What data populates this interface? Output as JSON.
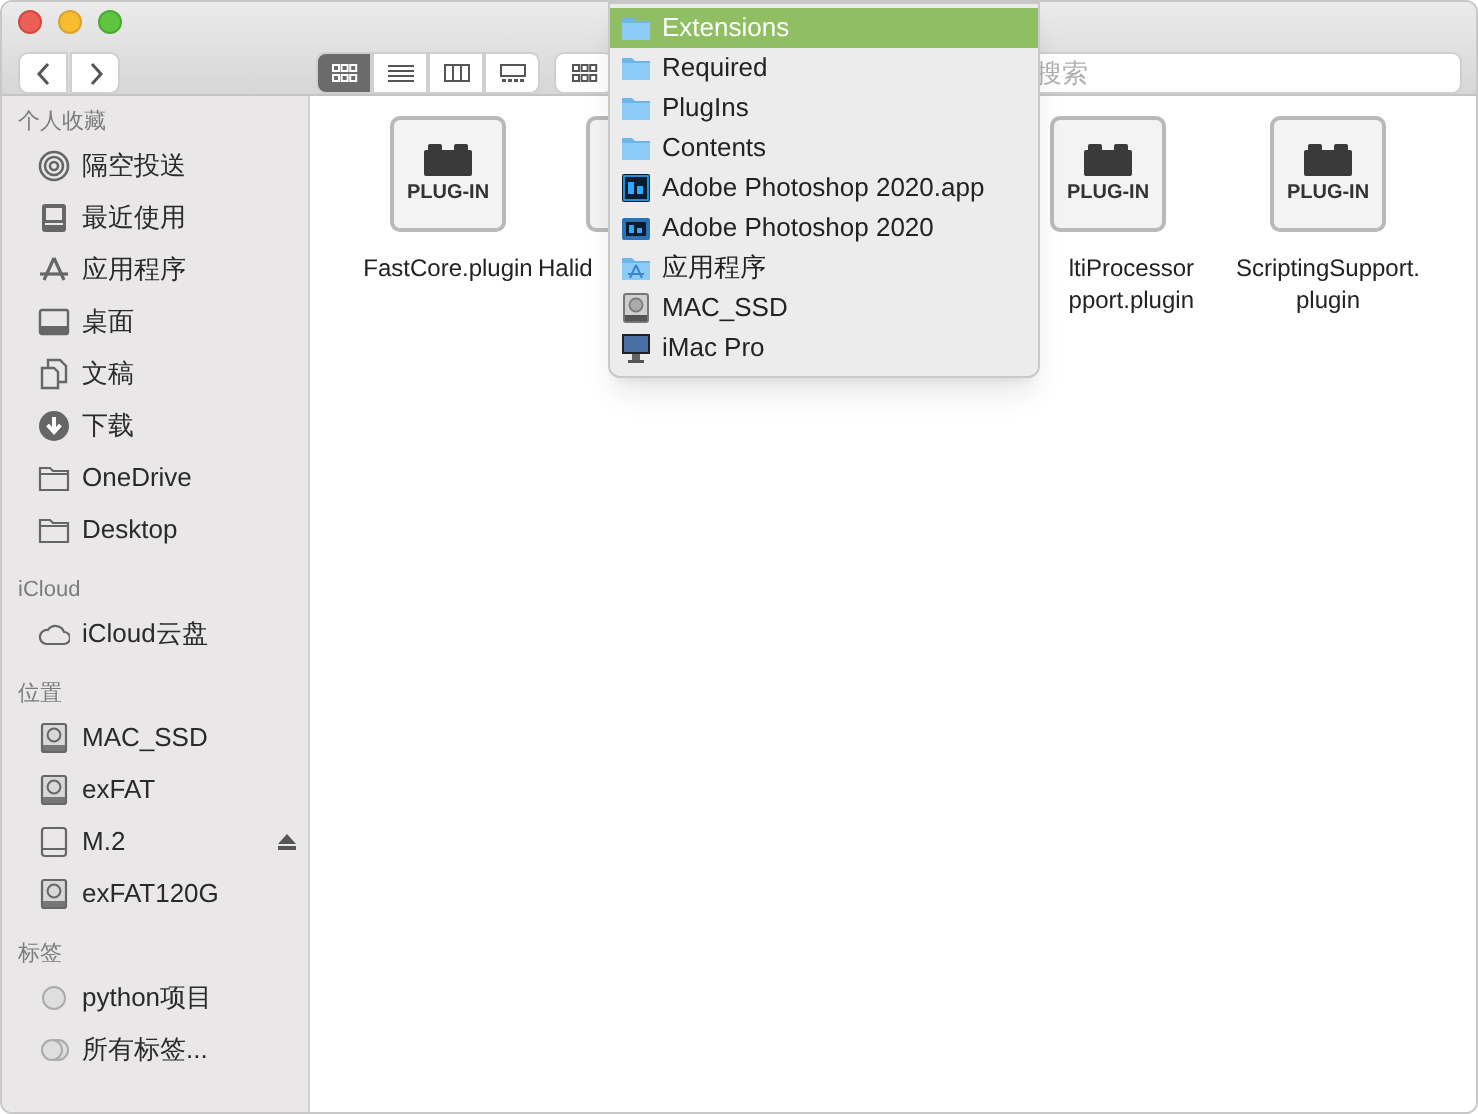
{
  "toolbar": {
    "views": [
      {
        "kind": "icons",
        "selected": true
      },
      {
        "kind": "list",
        "selected": false
      },
      {
        "kind": "columns",
        "selected": false
      },
      {
        "kind": "gallery",
        "selected": false
      }
    ],
    "search": {
      "placeholder": "搜索"
    }
  },
  "sidebar": {
    "sections": [
      {
        "title": "个人收藏",
        "items": [
          {
            "label": "隔空投送",
            "kind": "airdrop",
            "ejectable": false
          },
          {
            "label": "最近使用",
            "kind": "recent",
            "ejectable": false
          },
          {
            "label": "应用程序",
            "kind": "apps",
            "ejectable": false
          },
          {
            "label": "桌面",
            "kind": "desktop",
            "ejectable": false
          },
          {
            "label": "文稿",
            "kind": "document",
            "ejectable": false
          },
          {
            "label": "下载",
            "kind": "download",
            "ejectable": false
          },
          {
            "label": "OneDrive",
            "kind": "folder",
            "ejectable": false
          },
          {
            "label": "Desktop",
            "kind": "folder",
            "ejectable": false
          }
        ]
      },
      {
        "title": "iCloud",
        "items": [
          {
            "label": "iCloud云盘",
            "kind": "cloud",
            "ejectable": false
          }
        ]
      },
      {
        "title": "位置",
        "items": [
          {
            "label": "MAC_SSD",
            "kind": "disk",
            "ejectable": false
          },
          {
            "label": "exFAT",
            "kind": "disk",
            "ejectable": false
          },
          {
            "label": "M.2",
            "kind": "drive",
            "ejectable": true
          },
          {
            "label": "exFAT120G",
            "kind": "disk",
            "ejectable": false
          }
        ]
      },
      {
        "title": "标签",
        "items": [
          {
            "label": "python项目",
            "kind": "tag",
            "ejectable": false
          },
          {
            "label": "所有标签...",
            "kind": "tags",
            "ejectable": false
          }
        ]
      }
    ]
  },
  "files": [
    {
      "badge": "PLUG-IN",
      "name": [
        "FastCore.plugin"
      ]
    },
    {
      "name": [
        "Halid"
      ]
    },
    {
      "badge": "PLUG-IN",
      "name": [
        "ltiProcessor",
        "pport.plugin"
      ]
    },
    {
      "badge": "PLUG-IN",
      "name": [
        "ScriptingSupport.",
        "plugin"
      ]
    }
  ],
  "path_menu": {
    "items": [
      {
        "label": "Extensions",
        "kind": "folder",
        "selected": true
      },
      {
        "label": "Required",
        "kind": "folder",
        "selected": false
      },
      {
        "label": "PlugIns",
        "kind": "folder",
        "selected": false
      },
      {
        "label": "Contents",
        "kind": "folder",
        "selected": false
      },
      {
        "label": "Adobe Photoshop 2020.app",
        "kind": "ps-app",
        "selected": false
      },
      {
        "label": "Adobe Photoshop 2020",
        "kind": "ps-folder",
        "selected": false
      },
      {
        "label": "应用程序",
        "kind": "apps",
        "selected": false
      },
      {
        "label": "MAC_SSD",
        "kind": "disk",
        "selected": false
      },
      {
        "label": "iMac Pro",
        "kind": "computer",
        "selected": false
      }
    ]
  }
}
